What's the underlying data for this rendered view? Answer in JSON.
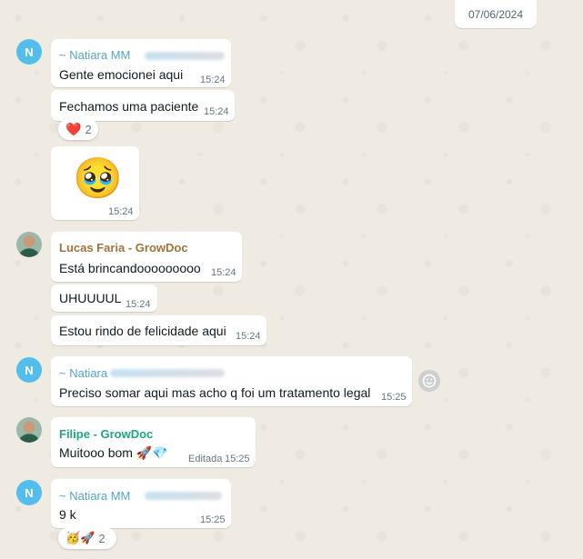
{
  "date": "07/06/2024",
  "messages": [
    {
      "sender": "~ Natiara MM",
      "text": "Gente emocionei aqui",
      "time": "15:24"
    },
    {
      "text": "Fechamos uma paciente",
      "time": "15:24",
      "reaction": {
        "emoji": "❤️",
        "count": "2"
      }
    },
    {
      "emoji": "🥹",
      "time": "15:24"
    },
    {
      "sender": "Lucas Faria - GrowDoc",
      "text": "Está brincandooooooooo",
      "time": "15:24"
    },
    {
      "text": "UHUUUUL",
      "time": "15:24"
    },
    {
      "text": "Estou rindo de felicidade aqui",
      "time": "15:24"
    },
    {
      "sender": "~ Natiara",
      "text": "Preciso somar aqui mas acho q foi um tratamento legal",
      "time": "15:25"
    },
    {
      "sender": "Filipe - GrowDoc",
      "text": "Muitooo bom",
      "emojis": "🚀💎",
      "edited": "Editada",
      "time": "15:25"
    },
    {
      "sender": "~ Natiara MM",
      "text": "9 k",
      "time": "15:25",
      "reaction": {
        "emoji": "🥳🚀",
        "count": "2"
      }
    }
  ],
  "avatar_initial": "N",
  "icons": {
    "react": "smiley-icon",
    "heart": "heart-icon"
  }
}
